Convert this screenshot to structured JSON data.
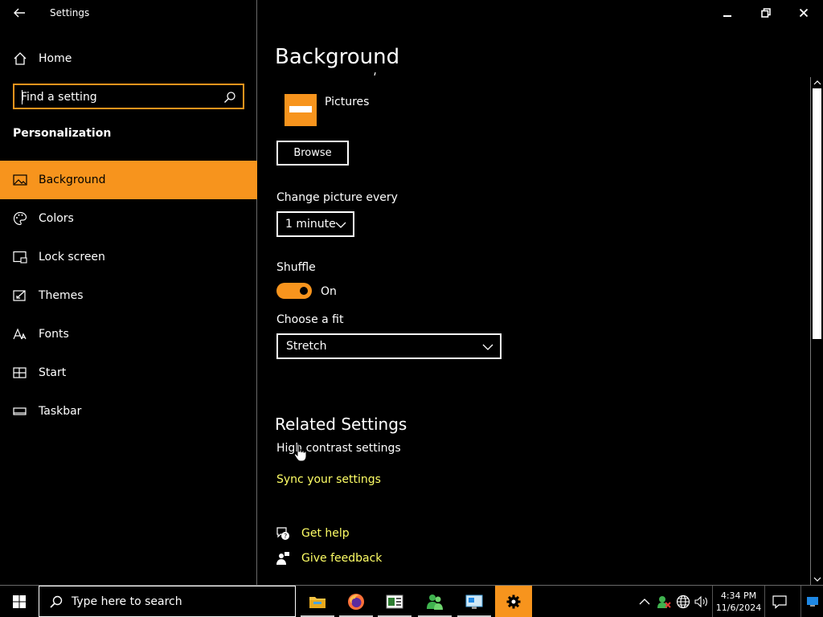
{
  "window": {
    "app_title": "Settings",
    "controls": {
      "minimize": "minimize-icon",
      "restore": "restore-icon",
      "close": "close-icon"
    }
  },
  "sidebar": {
    "home_label": "Home",
    "search": {
      "placeholder": "Find a setting",
      "value": ""
    },
    "section_title": "Personalization",
    "items": [
      {
        "label": "Background",
        "icon": "picture-icon",
        "active": true
      },
      {
        "label": "Colors",
        "icon": "palette-icon",
        "active": false
      },
      {
        "label": "Lock screen",
        "icon": "lock-screen-icon",
        "active": false
      },
      {
        "label": "Themes",
        "icon": "themes-icon",
        "active": false
      },
      {
        "label": "Fonts",
        "icon": "fonts-icon",
        "active": false
      },
      {
        "label": "Start",
        "icon": "start-icon",
        "active": false
      },
      {
        "label": "Taskbar",
        "icon": "taskbar-icon",
        "active": false
      }
    ]
  },
  "main": {
    "title": "Background",
    "album": {
      "label": "Pictures"
    },
    "browse_label": "Browse",
    "change_picture": {
      "label": "Change picture every",
      "value": "1 minute"
    },
    "shuffle": {
      "label": "Shuffle",
      "state": "On",
      "enabled": true
    },
    "fit": {
      "label": "Choose a fit",
      "value": "Stretch"
    },
    "related": {
      "title": "Related Settings",
      "high_contrast": "High contrast settings",
      "sync": "Sync your settings"
    },
    "help": {
      "get_help": "Get help",
      "give_feedback": "Give feedback"
    }
  },
  "taskbar": {
    "search_placeholder": "Type here to search",
    "apps": [
      "file-explorer-icon",
      "firefox-icon",
      "news-app-icon",
      "people-app-icon",
      "remote-desktop-icon",
      "settings-gear-icon"
    ],
    "clock": {
      "time": "4:34 PM",
      "date": "11/6/2024"
    }
  },
  "colors": {
    "accent": "#f7941d",
    "link": "#ffff66",
    "background": "#000000",
    "text": "#ffffff"
  }
}
